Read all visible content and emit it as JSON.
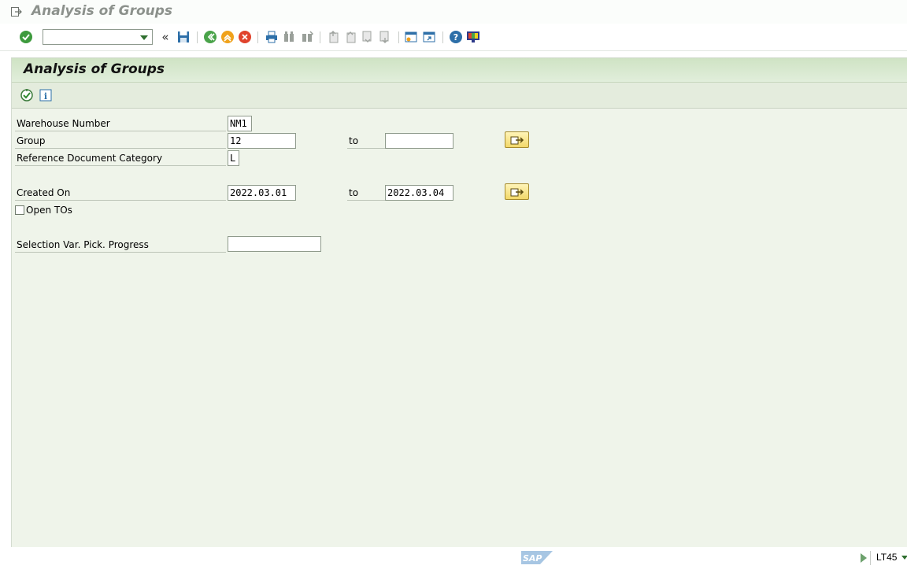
{
  "window": {
    "title": "Analysis of Groups"
  },
  "toolbar": {
    "command_field": {
      "value": "",
      "placeholder": ""
    },
    "buttons": [
      "enter-icon",
      "back-double-chevron-icon",
      "save-icon",
      "back-icon",
      "exit-icon",
      "cancel-icon",
      "print-icon",
      "find-icon",
      "find-next-icon",
      "first-page-icon",
      "previous-page-icon",
      "next-page-icon",
      "last-page-icon",
      "create-session-icon",
      "shortcut-icon",
      "help-icon",
      "customize-layout-icon"
    ]
  },
  "screen": {
    "header": "Analysis of Groups",
    "app_toolbar": [
      "execute-icon",
      "info-icon"
    ]
  },
  "form": {
    "warehouse": {
      "label": "Warehouse Number",
      "value": "NM1"
    },
    "group": {
      "label": "Group",
      "from": "12",
      "to_label": "to",
      "to": ""
    },
    "ref_doc_cat": {
      "label": "Reference Document Category",
      "value": "L"
    },
    "created_on": {
      "label": "Created On",
      "from": "2022.03.01",
      "to_label": "to",
      "to": "2022.03.04"
    },
    "open_tos": {
      "label": "Open TOs",
      "checked": false
    },
    "sel_var": {
      "label": "Selection Var. Pick. Progress",
      "value": ""
    }
  },
  "status": {
    "logo": "SAP",
    "tcode": "LT45"
  },
  "colors": {
    "accent": "#3d7a2f",
    "header_bg": "#cfe3c4",
    "screen_bg": "#eff4ea",
    "multi_select": "#f2d86a"
  }
}
